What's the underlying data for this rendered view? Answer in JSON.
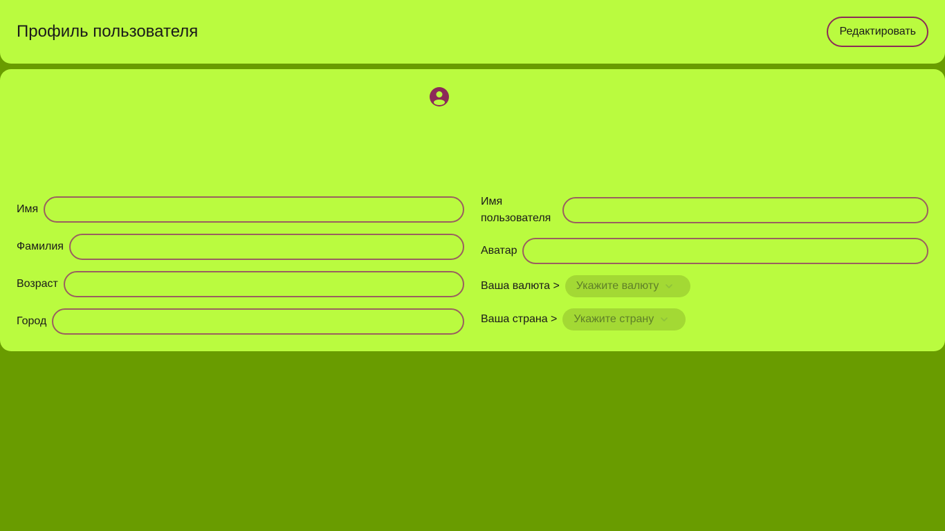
{
  "header": {
    "title": "Профиль пользователя",
    "edit_label": "Редактировать"
  },
  "avatar": {
    "icon": "user-circle-icon",
    "color": "#8c2a58"
  },
  "form": {
    "left": [
      {
        "label": "Имя",
        "value": ""
      },
      {
        "label": "Фамилия",
        "value": ""
      },
      {
        "label": "Возраст",
        "value": ""
      },
      {
        "label": "Город",
        "value": ""
      }
    ],
    "right": {
      "username_label": "Имя пользователя",
      "username_value": "",
      "avatar_label": "Аватар",
      "avatar_value": "",
      "currency_label": "Ваша валюта >",
      "currency_placeholder": "Укажите валюту",
      "country_label": "Ваша страна >",
      "country_placeholder": "Укажите страну"
    }
  },
  "colors": {
    "page_bg": "#699c00",
    "panel_bg": "#bafb3f",
    "accent": "#8c2a58"
  }
}
